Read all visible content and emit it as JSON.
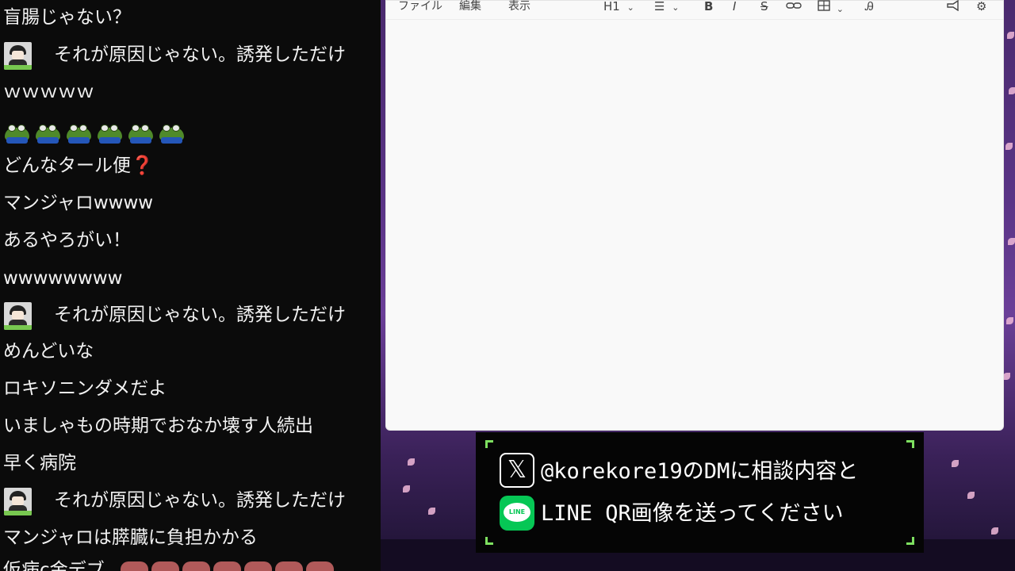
{
  "chat": {
    "messages": [
      {
        "text": "盲腸じゃない？"
      },
      {
        "text": "それが原因じゃない。誘発しただけ",
        "avatar": true
      },
      {
        "text": "ｗｗｗｗｗ"
      },
      {
        "emotes": "frog-emote",
        "count": 6
      },
      {
        "text": "どんなタール便",
        "suffix": "❓"
      },
      {
        "text": "マンジャロwwww"
      },
      {
        "text": "あるやろがい！"
      },
      {
        "text": "wwwwwwww"
      },
      {
        "text": "それが原因じゃない。誘発しただけ",
        "avatar": true
      },
      {
        "text": "めんどいな"
      },
      {
        "text": "ロキソニンダメだよ"
      },
      {
        "text": "いましゃもの時期でおなか壊す人続出"
      },
      {
        "text": "早く病院"
      },
      {
        "text": "それが原因じゃない。誘発しただけ",
        "avatar": true
      },
      {
        "text": "マンジャロは膵臓に負担かかる"
      },
      {
        "text": "仮病с金デブ"
      }
    ]
  },
  "editor": {
    "menu": {
      "file": "ファイル",
      "edit": "編集",
      "view": "表示"
    },
    "toolbar": {
      "heading": "H1",
      "list_icon": "list-icon",
      "bold": "B",
      "italic": "I",
      "strike": "S",
      "link_icon": "link-icon",
      "table_icon": "table-icon",
      "spell_icon": "spellcheck-icon",
      "announce_icon": "megaphone-icon",
      "settings_icon": "gear-icon"
    }
  },
  "infobox": {
    "line1": "@korekore19のDMに相談内容と",
    "line2": "LINE QR画像を送ってください",
    "x_icon": "𝕏",
    "line_icon_label": "LINE",
    "accent": "#7ee060"
  }
}
